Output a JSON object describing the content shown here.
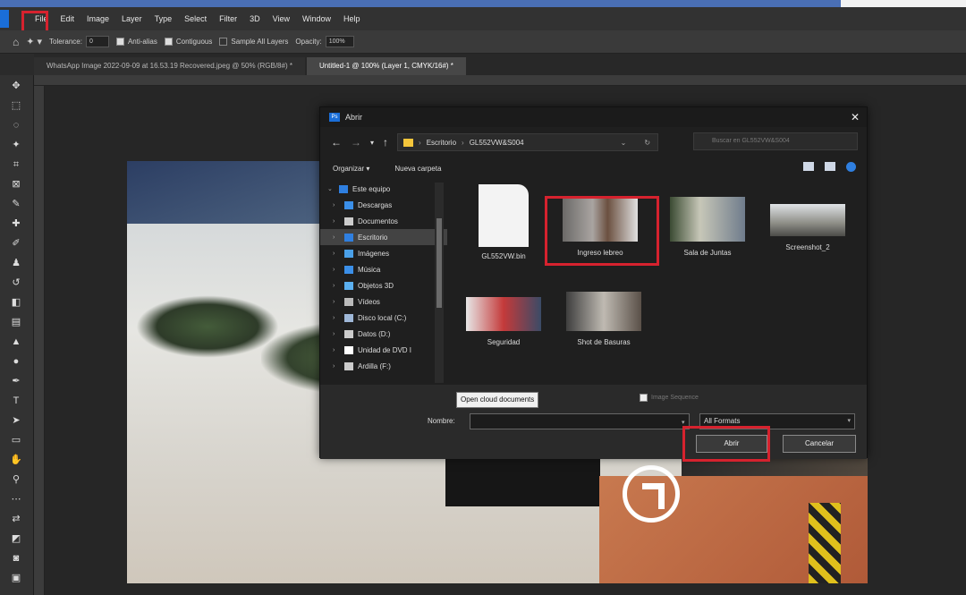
{
  "menubar": {
    "items": [
      "File",
      "Edit",
      "Image",
      "Layer",
      "Type",
      "Select",
      "Filter",
      "3D",
      "View",
      "Window",
      "Help"
    ]
  },
  "options": {
    "tolerance_label": "Tolerance:",
    "tolerance_value": "0",
    "antialias": "Anti-alias",
    "contiguous": "Contiguous",
    "sample_all": "Sample All Layers",
    "opacity_label": "Opacity:",
    "opacity_value": "100%"
  },
  "tabs": [
    {
      "label": "WhatsApp Image 2022-09-09 at 16.53.19 Recovered.jpeg @ 50% (RGB/8#) *"
    },
    {
      "label": "Untitled-1 @ 100% (Layer 1, CMYK/16#) *"
    }
  ],
  "dialog": {
    "title": "Abrir",
    "path": [
      "Escritorio",
      "GL552VW&S004"
    ],
    "search_placeholder": "Buscar en GL552VW&S004",
    "organize": "Organizar ▾",
    "new_folder": "Nueva carpeta",
    "nav": [
      {
        "label": "Este equipo",
        "icon": "computer-icon",
        "color": "#2f7fe0"
      },
      {
        "label": "Descargas",
        "icon": "download-icon",
        "color": "#3b8fe8"
      },
      {
        "label": "Documentos",
        "icon": "document-icon",
        "color": "#cccccc"
      },
      {
        "label": "Escritorio",
        "icon": "desktop-icon",
        "color": "#2f7fe0"
      },
      {
        "label": "Imágenes",
        "icon": "image-icon",
        "color": "#4aa0e8"
      },
      {
        "label": "Música",
        "icon": "music-icon",
        "color": "#3b8fe8"
      },
      {
        "label": "Objetos 3D",
        "icon": "cube-icon",
        "color": "#5bb0f0"
      },
      {
        "label": "Vídeos",
        "icon": "video-icon",
        "color": "#bbbbbb"
      },
      {
        "label": "Disco local (C:)",
        "icon": "drive-icon",
        "color": "#9fb8d8"
      },
      {
        "label": "Datos (D:)",
        "icon": "drive-icon",
        "color": "#cccccc"
      },
      {
        "label": "Unidad de DVD I",
        "icon": "dvd-icon",
        "color": "#ffffff"
      },
      {
        "label": "Ardilla (F:)",
        "icon": "drive-icon",
        "color": "#cccccc"
      }
    ],
    "files": [
      {
        "name": "GL552VW.bin",
        "type": "doc"
      },
      {
        "name": "Ingreso lebreo",
        "type": "image"
      },
      {
        "name": "Sala de Juntas",
        "type": "image"
      },
      {
        "name": "Screenshot_2",
        "type": "image"
      },
      {
        "name": "Seguridad",
        "type": "image"
      },
      {
        "name": "Shot de Basuras",
        "type": "image"
      }
    ],
    "open_cloud": "Open cloud documents",
    "image_sequence": "Image Sequence",
    "name_label": "Nombre:",
    "format": "All Formats",
    "open": "Abrir",
    "cancel": "Cancelar"
  },
  "colors": {
    "highlight": "#d6222e",
    "accent": "#1a6ed8"
  }
}
